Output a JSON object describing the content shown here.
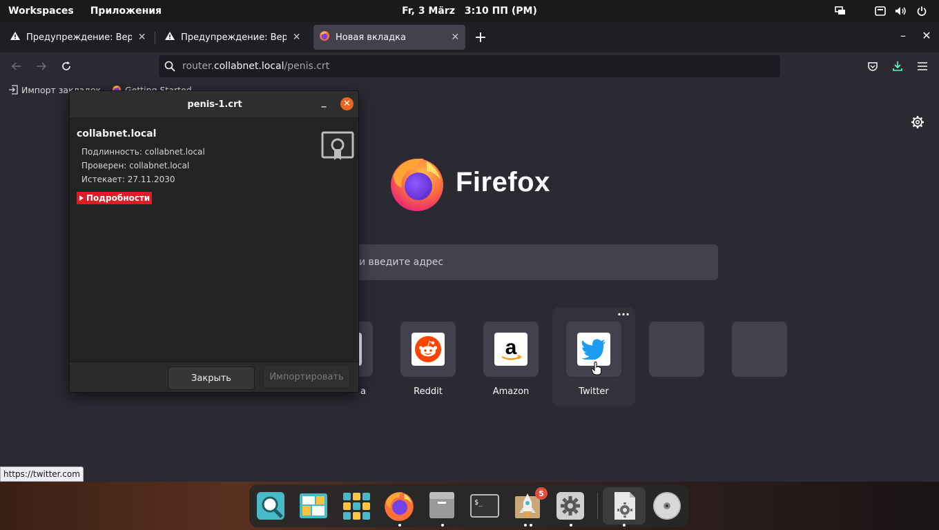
{
  "top_panel": {
    "workspaces_label": "Workspaces",
    "apps_label": "Приложения",
    "date": "Fr, 3 März",
    "time": "3:10 ПП (PM)"
  },
  "tabs": [
    {
      "title": "Предупреждение: Вероятная угроза безопасности",
      "icon": "warning-icon",
      "active": false
    },
    {
      "title": "Предупреждение: Вероятная угроза безопасности",
      "icon": "warning-icon",
      "active": false
    },
    {
      "title": "Новая вкладка",
      "icon": "firefox-icon",
      "active": true
    }
  ],
  "urlbar": {
    "prefix": "router.",
    "host": "collabnet.local",
    "path": "/penis.crt"
  },
  "bookmarks": [
    {
      "label": "Импорт закладок...",
      "icon": "import-icon"
    },
    {
      "label": "Getting Started",
      "icon": "firefox-icon"
    }
  ],
  "newtab": {
    "brand": "Firefox",
    "search_placeholder": "Введите запрос или введите адрес",
    "search_placeholder_visible": "и введите адрес",
    "tiles": [
      {
        "label": "Wikipedia",
        "label_visible": "a",
        "icon": "wikipedia-icon"
      },
      {
        "label": "Reddit",
        "icon": "reddit-icon"
      },
      {
        "label": "Amazon",
        "icon": "amazon-icon"
      },
      {
        "label": "Twitter",
        "icon": "twitter-icon"
      },
      {
        "label": "",
        "icon": "empty"
      },
      {
        "label": "",
        "icon": "empty"
      }
    ]
  },
  "status_url": "https://twitter.com",
  "dialog": {
    "title": "penis-1.crt",
    "host": "collabnet.local",
    "issued_to": "Подлинность: collabnet.local",
    "verified_by": "Проверен: collabnet.local",
    "expires": "Истекает: 27.11.2030",
    "details_label": "Подробности",
    "close_button": "Закрыть",
    "import_button": "Импортировать"
  },
  "dock": {
    "items": [
      "search-app",
      "files-manager",
      "app-grid",
      "firefox",
      "file-cabinet",
      "terminal",
      "app-installer",
      "settings",
      "certificate-viewer",
      "disc"
    ],
    "badge_count": "5"
  },
  "colors": {
    "accent": "#e8661f",
    "danger": "#e01b24",
    "toolbar": "#2b2a33",
    "tab_active": "#42414d"
  }
}
